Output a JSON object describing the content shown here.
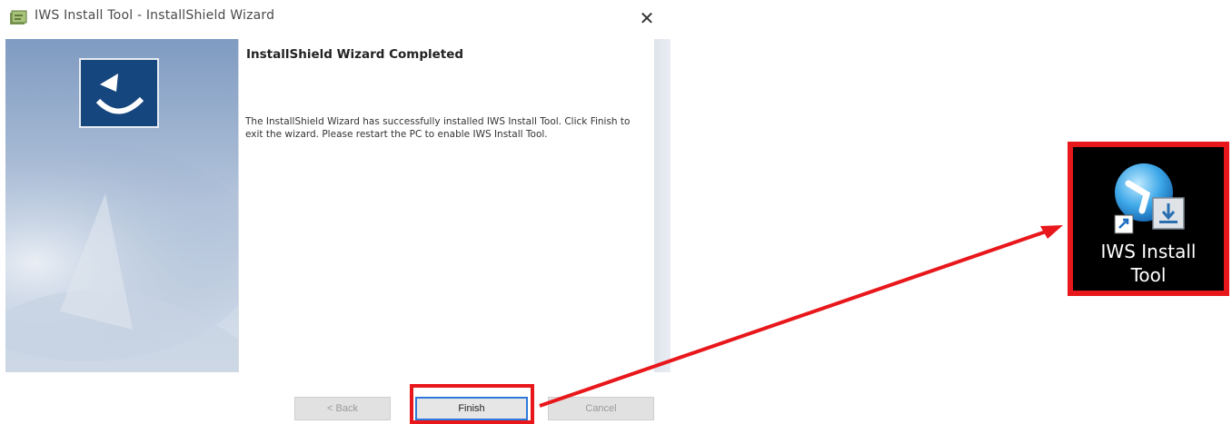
{
  "window": {
    "title": "IWS Install Tool - InstallShield Wizard",
    "close_symbol": "✕"
  },
  "content": {
    "heading": "InstallShield Wizard Completed",
    "body": "The InstallShield Wizard has successfully installed IWS Install Tool. Click Finish to exit the wizard. Please restart the PC to enable IWS Install Tool."
  },
  "buttons": {
    "back": "< Back",
    "finish": "Finish",
    "cancel": "Cancel"
  },
  "desktop_shortcut": {
    "label_line1": "IWS Install",
    "label_line2": "Tool",
    "icon": "iws-install-tool-icon"
  },
  "colors": {
    "highlight": "#e8171b",
    "side_panel": "#a9bbd3",
    "finish_border": "#2d78d8"
  }
}
